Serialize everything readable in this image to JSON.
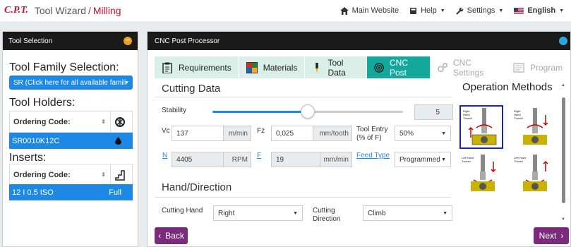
{
  "nav": {
    "brand": "C.P.T.",
    "app_title": "Tool Wizard",
    "separator": "/",
    "mode": "Milling",
    "main_website": "Main Website",
    "help": "Help",
    "settings": "Settings",
    "language": "English"
  },
  "left": {
    "header": "Tool Selection",
    "collapse_symbol": "−",
    "family_title": "Tool Family Selection:",
    "family_button": "SR (Click here for all available famili",
    "holders_title": "Tool Holders:",
    "holders_col": "Ordering Code:",
    "holder_selected": "SR0010K12C",
    "inserts_title": "Inserts:",
    "inserts_col": "Ordering Code:",
    "insert_selected": "12 I 0.5 ISO",
    "insert_profile": "Full"
  },
  "right": {
    "header": "CNC Post Processor",
    "tabs": [
      {
        "label": "Requirements",
        "icon": "clipboard-icon"
      },
      {
        "label": "Materials",
        "icon": "materials-grid-icon"
      },
      {
        "label": "Tool Data",
        "icon": "tool-icon"
      },
      {
        "label": "CNC Post",
        "icon": "cnc-gauge-icon"
      },
      {
        "label": "CNC Settings",
        "icon": "gears-icon"
      },
      {
        "label": "Program",
        "icon": "program-list-icon"
      }
    ],
    "cutting_data": {
      "title": "Cutting Data",
      "stability_label": "Stability",
      "stability_value": "5",
      "stability_fraction": 0.5,
      "vc_label": "Vc",
      "vc_value": "137",
      "vc_unit": "m/min",
      "fz_label": "Fz",
      "fz_value": "0,025",
      "fz_unit": "mm/tooth",
      "tool_entry_label_1": "Tool Entry",
      "tool_entry_label_2": "(% of F)",
      "tool_entry_value": "50%",
      "n_label": "N",
      "n_value": "4405",
      "n_unit": "RPM",
      "f_label": "F",
      "f_value": "19",
      "f_unit": "mm/min",
      "feed_type_label": "Feed Type",
      "feed_type_value": "Programmed"
    },
    "hand": {
      "title": "Hand/Direction",
      "cutting_hand_label": "Cutting Hand",
      "cutting_hand_value": "Right",
      "cutting_direction_label_1": "Cutting",
      "cutting_direction_label_2": "Direction",
      "cutting_direction_value": "Climb"
    },
    "operation_methods": {
      "title": "Operation Methods",
      "items": [
        {
          "label": "Right Hand Thread",
          "selected": true
        },
        {
          "label": "Right Hand Thread",
          "selected": false
        },
        {
          "label": "Left Hand Thread",
          "selected": false
        },
        {
          "label": "Left Hand Thread",
          "selected": false
        }
      ]
    },
    "back_label": "Back",
    "next_label": "Next",
    "back_arrow": "‹",
    "next_arrow": "›"
  }
}
